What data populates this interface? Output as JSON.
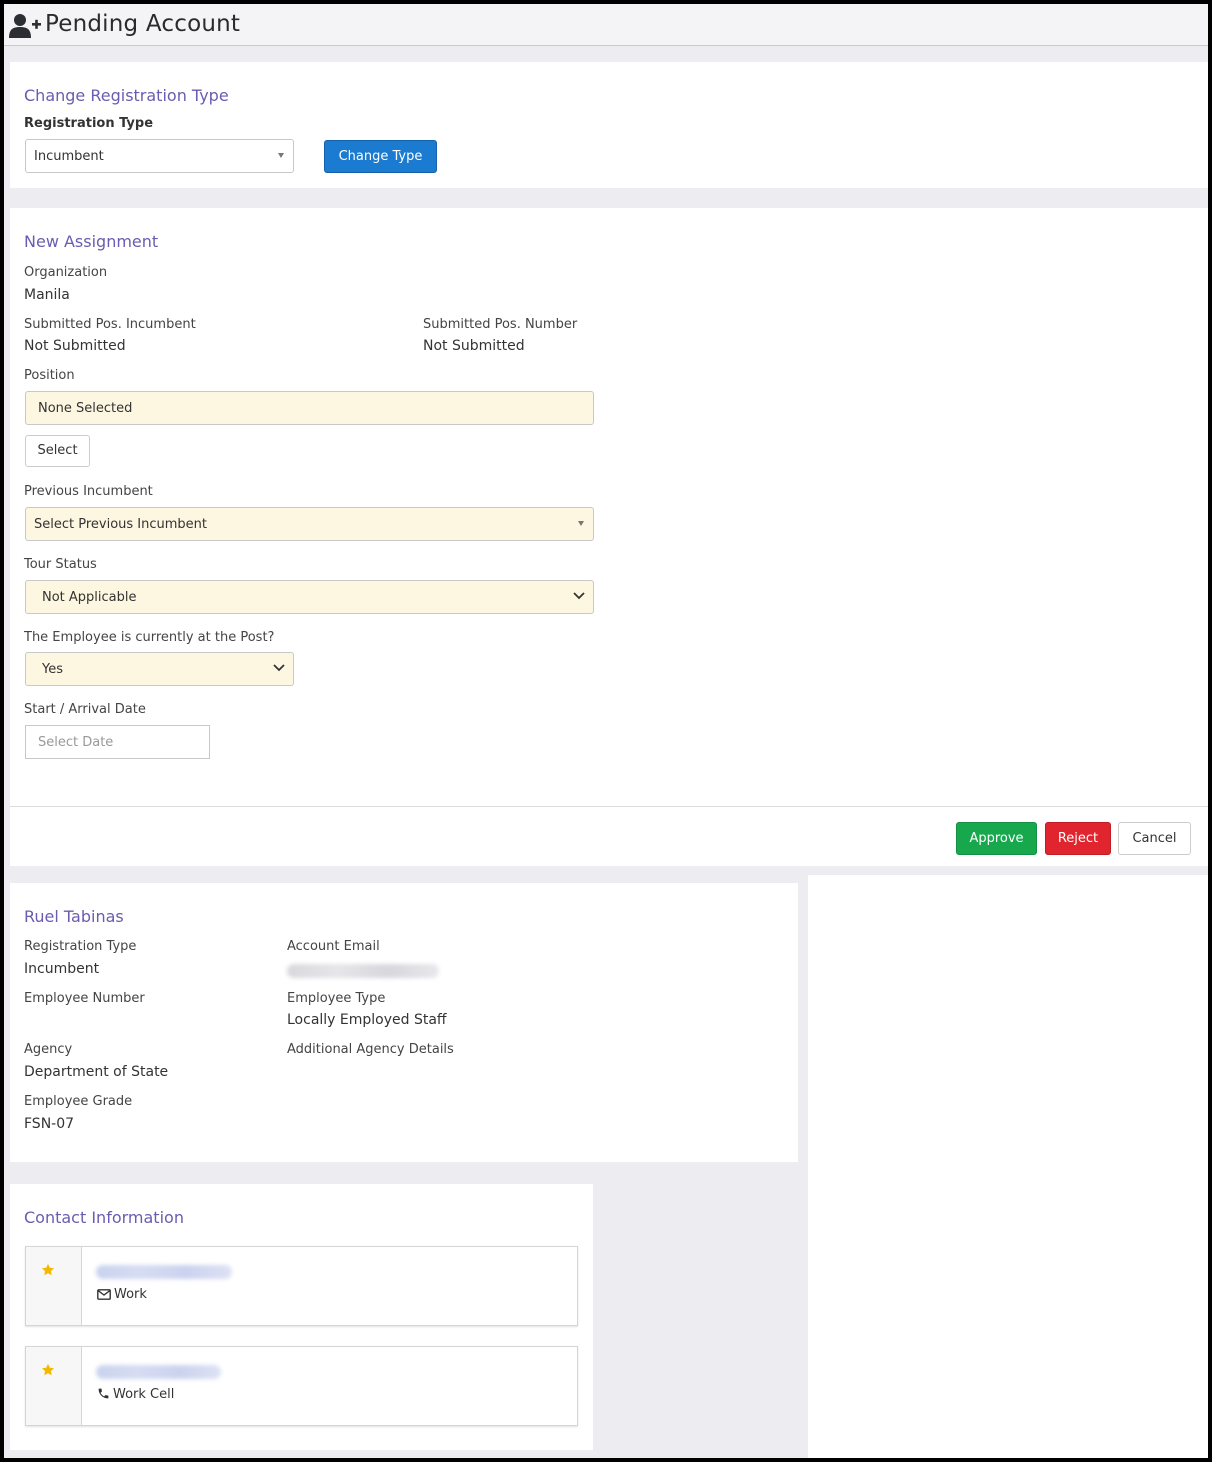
{
  "header": {
    "title": "Pending Account",
    "icon": "user-plus-icon"
  },
  "registration": {
    "section_title": "Change Registration Type",
    "field_label": "Registration Type",
    "selected_value": "Incumbent",
    "change_button": "Change Type"
  },
  "assignment": {
    "section_title": "New Assignment",
    "organization_label": "Organization",
    "organization_value": "Manila",
    "submitted_incumbent_label": "Submitted Pos. Incumbent",
    "submitted_incumbent_value": "Not Submitted",
    "submitted_number_label": "Submitted Pos. Number",
    "submitted_number_value": "Not Submitted",
    "position_label": "Position",
    "position_value": "None Selected",
    "select_button": "Select",
    "previous_incumbent_label": "Previous Incumbent",
    "previous_incumbent_placeholder": "Select Previous Incumbent",
    "tour_status_label": "Tour Status",
    "tour_status_value": "Not Applicable",
    "at_post_label": "The Employee is currently at the Post?",
    "at_post_value": "Yes",
    "start_date_label": "Start / Arrival Date",
    "start_date_placeholder": "Select Date"
  },
  "actions": {
    "approve": "Approve",
    "reject": "Reject",
    "cancel": "Cancel"
  },
  "profile": {
    "name": "Ruel Tabinas",
    "registration_type_label": "Registration Type",
    "registration_type_value": "Incumbent",
    "account_email_label": "Account Email",
    "employee_number_label": "Employee Number",
    "employee_type_label": "Employee Type",
    "employee_type_value": "Locally Employed Staff",
    "agency_label": "Agency",
    "agency_value": "Department of State",
    "additional_agency_label": "Additional Agency Details",
    "employee_grade_label": "Employee Grade",
    "employee_grade_value": "FSN-07"
  },
  "contact": {
    "section_title": "Contact Information",
    "items": [
      {
        "type": "Work",
        "icon": "envelope-icon",
        "primary_icon": "star-icon"
      },
      {
        "type": "Work Cell",
        "icon": "phone-icon",
        "primary_icon": "star-icon"
      }
    ]
  },
  "colors": {
    "section_title": "#6c5bb0",
    "primary": "#1a7bd0",
    "success": "#17a84e",
    "danger": "#e0252f",
    "highlight_field": "#fdf6e0",
    "star": "#f5b800"
  }
}
